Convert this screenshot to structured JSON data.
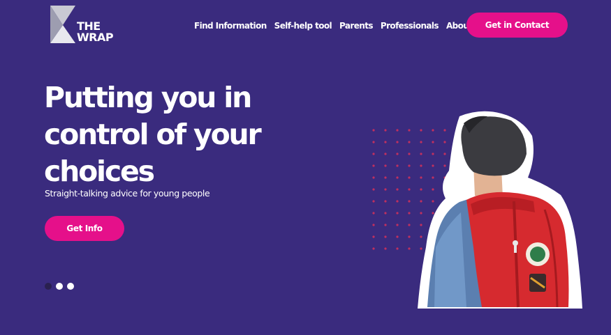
{
  "logo": {
    "line1": "THE",
    "line2": "WRAP",
    "icon": "hourglass-logo-icon"
  },
  "nav": {
    "items": [
      {
        "label": "Find Information"
      },
      {
        "label": "Self-help tool"
      },
      {
        "label": "Parents"
      },
      {
        "label": "Professionals"
      },
      {
        "label": "About The Wrap"
      }
    ],
    "cta_label": "Get in Contact"
  },
  "hero": {
    "title_lines": [
      "Putting you in",
      "control of your",
      "choices"
    ],
    "subtitle": "Straight-talking advice for young people",
    "cta_label": "Get Info",
    "carousel": {
      "total": 3,
      "active_index": 0
    }
  },
  "colors": {
    "background": "#3a2b7e",
    "accent": "#e5108a",
    "dot_pattern": "#c0305f",
    "text": "#ffffff"
  }
}
